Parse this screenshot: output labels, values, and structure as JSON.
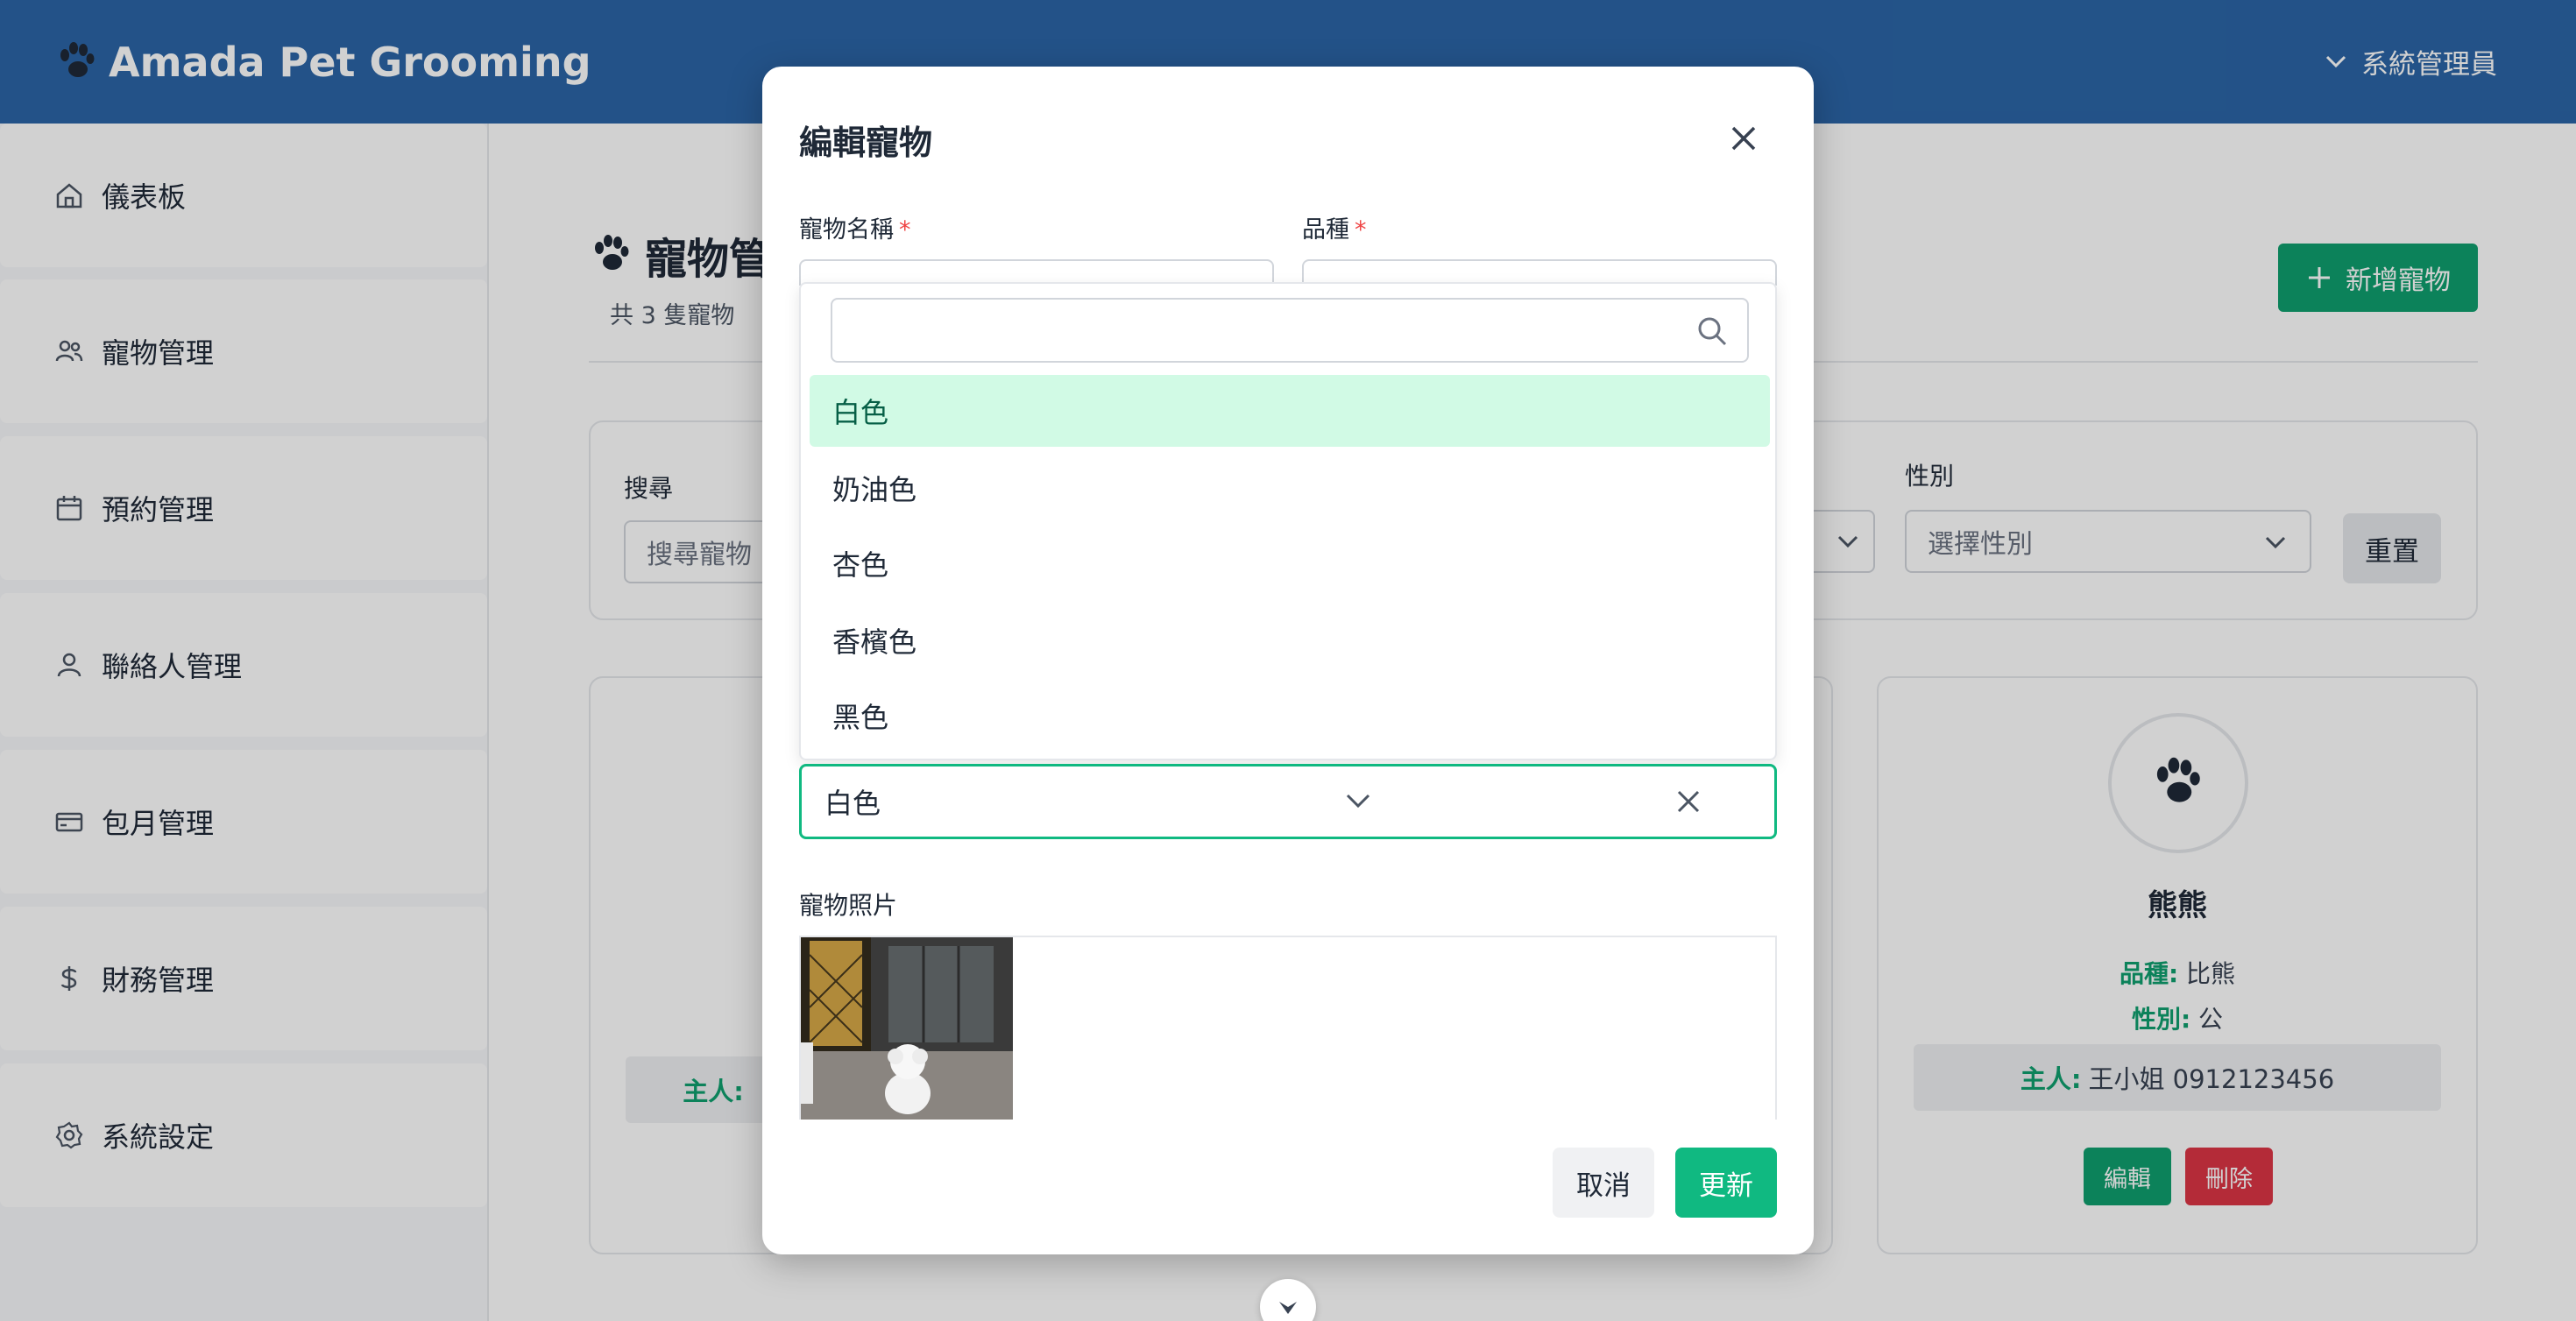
{
  "app": {
    "brand": "Amada Pet Grooming",
    "user_menu": "系統管理員"
  },
  "sidebar": {
    "items": [
      {
        "label": "儀表板",
        "icon": "home-icon"
      },
      {
        "label": "寵物管理",
        "icon": "users-icon"
      },
      {
        "label": "預約管理",
        "icon": "calendar-icon"
      },
      {
        "label": "聯絡人管理",
        "icon": "user-icon"
      },
      {
        "label": "包月管理",
        "icon": "credit-card-icon"
      },
      {
        "label": "財務管理",
        "icon": "dollar-icon"
      },
      {
        "label": "系統設定",
        "icon": "gear-icon"
      }
    ]
  },
  "page": {
    "title": "寵物管",
    "subtitle": "共 3 隻寵物",
    "add_button": "新增寵物"
  },
  "filters": {
    "search_label": "搜尋",
    "search_placeholder": "搜尋寵物",
    "gender_label": "性別",
    "gender_placeholder": "選擇性別",
    "reset": "重置"
  },
  "cards": {
    "left_owner_label": "主人:",
    "right": {
      "name": "熊熊",
      "breed_label": "品種:",
      "breed": "比熊",
      "gender_label": "性別:",
      "gender": "公",
      "owner_label": "主人:",
      "owner": "王小姐 0912123456",
      "edit": "編輯",
      "delete": "刪除"
    }
  },
  "modal": {
    "title": "編輯寵物",
    "pet_name_label": "寵物名稱",
    "breed_label": "品種",
    "required_mark": "*",
    "color_options": [
      "白色",
      "奶油色",
      "杏色",
      "香檳色",
      "黑色"
    ],
    "selected_color": "白色",
    "photo_label": "寵物照片",
    "cancel": "取消",
    "update": "更新"
  },
  "colors": {
    "header": "#2b65a6",
    "accent": "#10b981",
    "accent_dark": "#0f9f6e",
    "danger": "#dc3545",
    "selected_bg": "#d1fae5"
  }
}
